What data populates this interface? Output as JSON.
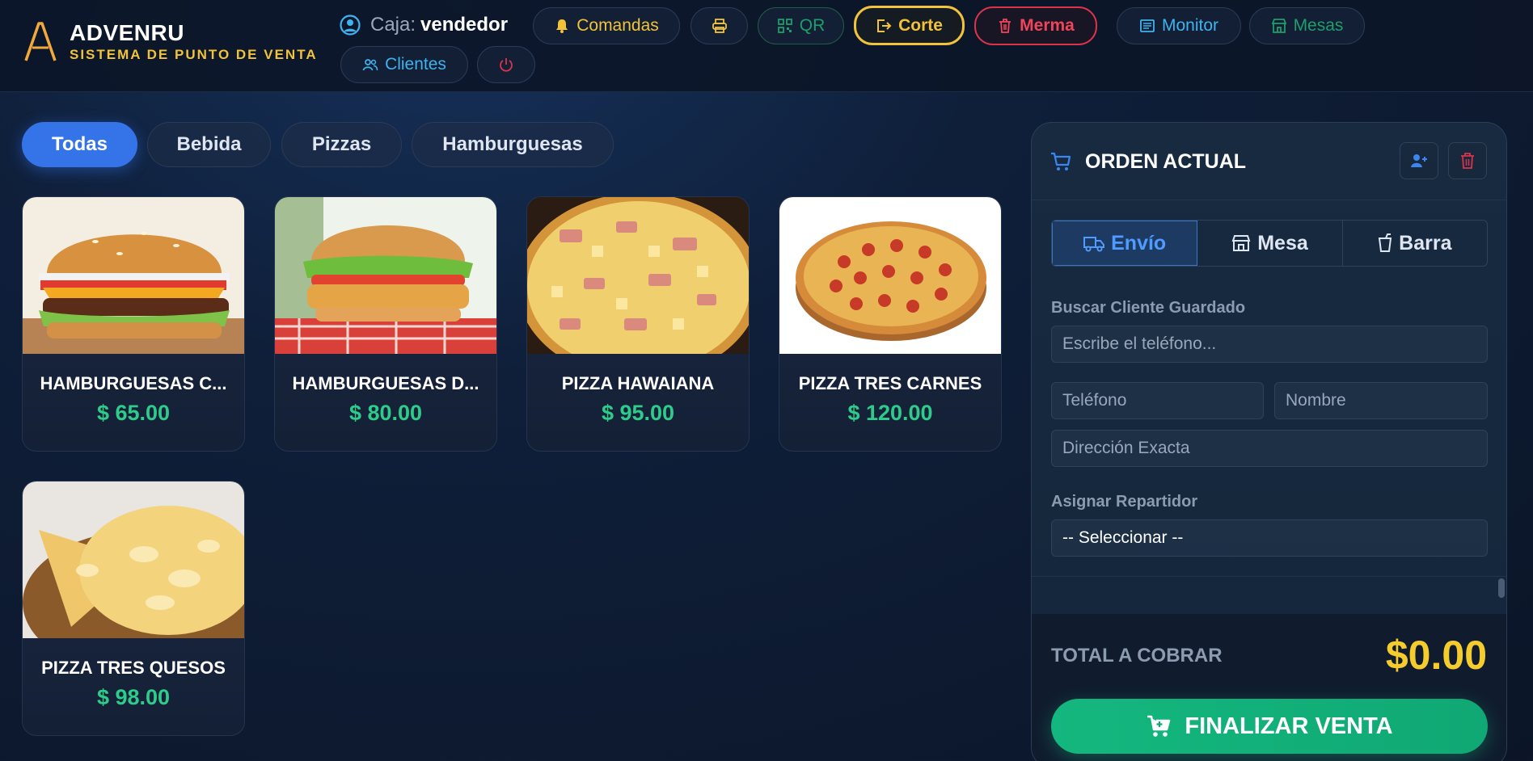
{
  "brand": {
    "logo_letter": "A",
    "name": "ADVENRU",
    "subtitle": "SISTEMA DE PUNTO DE VENTA"
  },
  "cashier": {
    "label": "Caja:",
    "user": "vendedor",
    "icon": "user-circle-icon"
  },
  "header_buttons": {
    "comandas": "Comandas",
    "qr": "QR",
    "corte": "Corte",
    "merma": "Merma",
    "monitor": "Monitor",
    "mesas": "Mesas",
    "clientes": "Clientes"
  },
  "categories": [
    "Todas",
    "Bebida",
    "Pizzas",
    "Hamburguesas"
  ],
  "active_category": "Todas",
  "products": [
    {
      "name": "HAMBURGUESAS C...",
      "price": "$ 65.00",
      "image": "burger-cheese-image"
    },
    {
      "name": "HAMBURGUESAS D...",
      "price": "$ 80.00",
      "image": "burger-chicken-image"
    },
    {
      "name": "PIZZA HAWAIANA",
      "price": "$ 95.00",
      "image": "pizza-hawaiian-image"
    },
    {
      "name": "PIZZA TRES CARNES",
      "price": "$ 120.00",
      "image": "pizza-pepperoni-image"
    },
    {
      "name": "PIZZA TRES QUESOS",
      "price": "$ 98.00",
      "image": "pizza-cheese-image"
    }
  ],
  "order": {
    "title": "ORDEN ACTUAL",
    "modes": [
      "Envío",
      "Mesa",
      "Barra"
    ],
    "active_mode": "Envío",
    "search_label": "Buscar Cliente Guardado",
    "search_placeholder": "Escribe el teléfono...",
    "phone_placeholder": "Teléfono",
    "name_placeholder": "Nombre",
    "address_placeholder": "Dirección Exacta",
    "courier_label": "Asignar Repartidor",
    "courier_selected": "-- Seleccionar --",
    "total_label": "TOTAL A COBRAR",
    "total_value": "$0.00",
    "finalize_label": "FINALIZAR VENTA"
  },
  "colors": {
    "accent_blue": "#3474e8",
    "price_green": "#2ecc8a",
    "gold": "#f2c23a",
    "danger": "#ef4459",
    "total_yellow": "#f5cc2d",
    "finalize_green": "#14b77f"
  }
}
